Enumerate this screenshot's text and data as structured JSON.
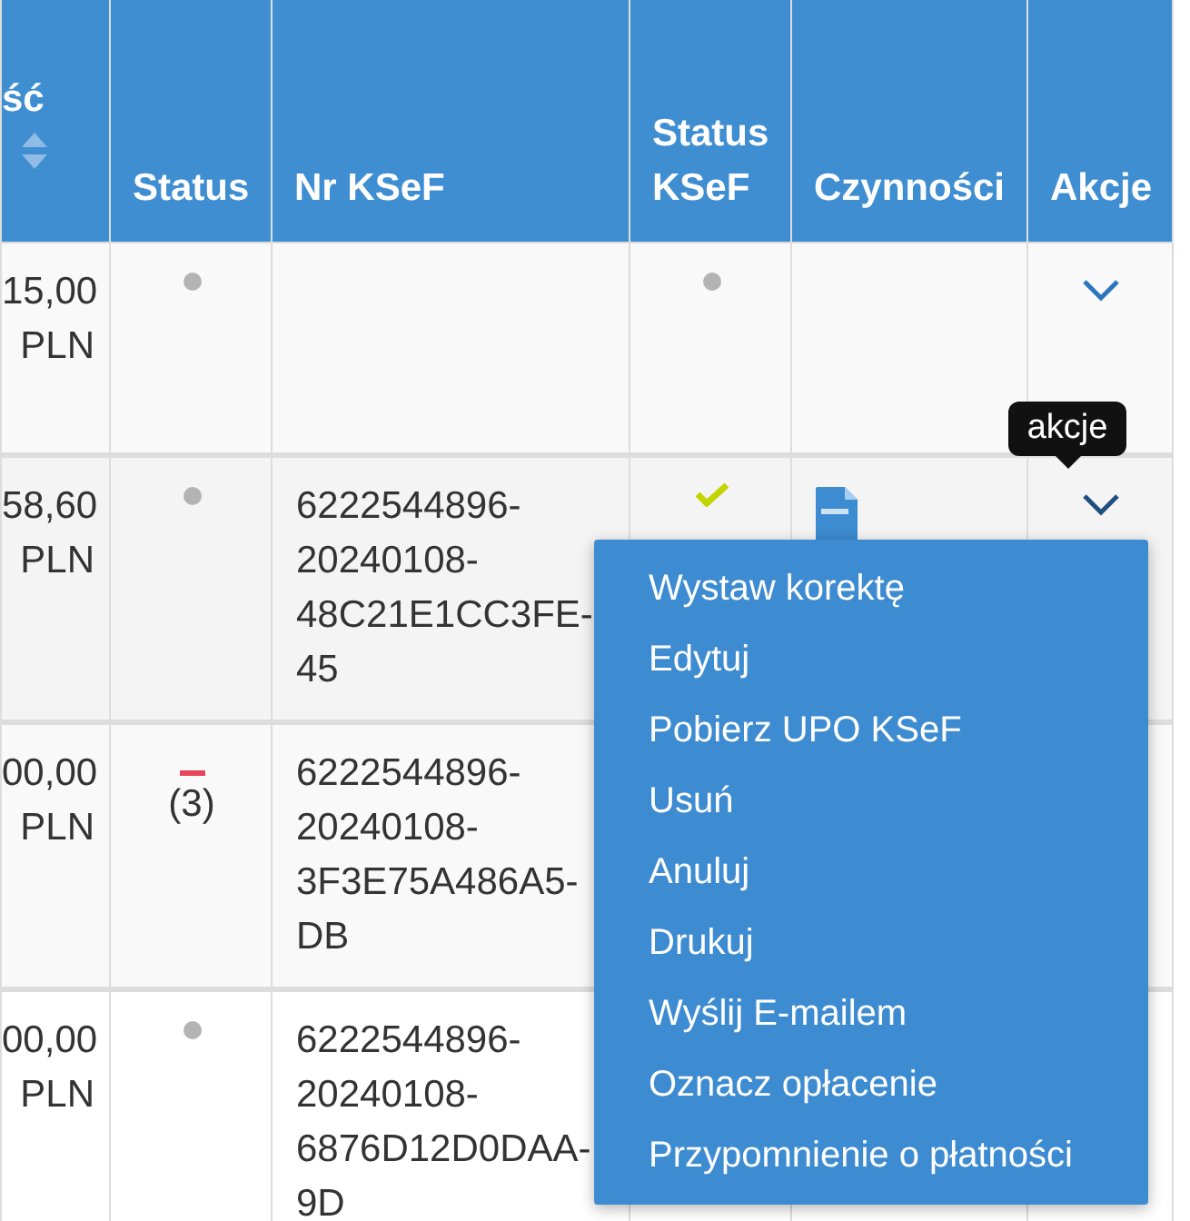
{
  "table": {
    "columns": [
      {
        "label": "ść",
        "sortable": true
      },
      {
        "label": "Status",
        "sortable": false
      },
      {
        "label": "Nr KSeF",
        "sortable": false
      },
      {
        "label": "Status KSeF",
        "sortable": false
      },
      {
        "label": "Czynności",
        "sortable": false
      },
      {
        "label": "Akcje",
        "sortable": false
      }
    ],
    "rows": [
      {
        "amount": "15,00 PLN",
        "status": {
          "kind": "dot"
        },
        "ksef_number": "",
        "ksef_status": {
          "kind": "dot"
        },
        "ksef_file": false,
        "menu_button": true
      },
      {
        "amount": "58,60 PLN",
        "status": {
          "kind": "dot"
        },
        "ksef_number": "6222544896-20240108-48C21E1CC3FE-45",
        "ksef_status": {
          "kind": "check"
        },
        "ksef_file": true,
        "menu_button": true
      },
      {
        "amount": "00,00 PLN",
        "status": {
          "kind": "error",
          "count": "(3)"
        },
        "ksef_number": "6222544896-20240108-3F3E75A486A5-DB",
        "ksef_file": false,
        "menu_button": false
      },
      {
        "amount": "00,00 PLN",
        "status": {
          "kind": "dot"
        },
        "ksef_number": "6222544896-20240108-6876D12D0DAA-9D",
        "ksef_file": false,
        "menu_button": false
      }
    ]
  },
  "tooltip": {
    "text": "akcje"
  },
  "actions_menu": {
    "items": [
      "Wystaw korektę",
      "Edytuj",
      "Pobierz UPO KSeF",
      "Usuń",
      "Anuluj",
      "Drukuj",
      "Wyślij E-mailem",
      "Oznacz opłacenie",
      "Przypomnienie o płatności"
    ]
  }
}
